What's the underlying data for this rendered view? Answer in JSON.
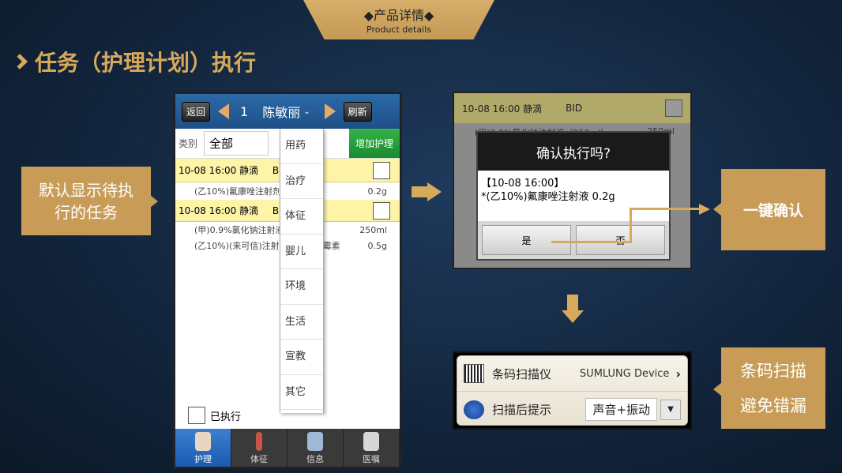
{
  "banner": {
    "title": "◆产品详情◆",
    "subtitle": "Product details"
  },
  "heading": "任务（护理计划）执行",
  "callouts": {
    "left": "默认显示待执行的任务",
    "confirm": "一键确认",
    "scan": "条码扫描",
    "scan2": "避免错漏"
  },
  "phone": {
    "back": "返回",
    "index": "1",
    "patient": "陈敏丽",
    "refresh": "刷新",
    "category_label": "类别",
    "category_value": "全部",
    "add_btn": "增加护理",
    "tasks": [
      {
        "header": "10-08 16:00 静滴",
        "freq": "B",
        "lines": [
          {
            "name": "(乙10%)氟康唑注射剂",
            "amount": "0.2g"
          }
        ]
      },
      {
        "header": "10-08 16:00 静滴",
        "freq": "B",
        "lines": [
          {
            "name": "(甲)0.9%氯化钠注射液",
            "amount": "250ml"
          },
          {
            "name": "(乙10%)(来可信)注射用头孢…古霉素",
            "amount": "0.5g"
          }
        ]
      }
    ],
    "menu": [
      "用药",
      "治疗",
      "体征",
      "婴儿",
      "环境",
      "生活",
      "宣教",
      "其它"
    ],
    "done_label": "已执行",
    "tabs": [
      {
        "label": "护理"
      },
      {
        "label": "体征"
      },
      {
        "label": "信息"
      },
      {
        "label": "医嘱"
      }
    ]
  },
  "dialog": {
    "bg_row1": "10-08 16:00 静滴",
    "bg_freq": "BID",
    "bg_line": "(甲)0.9%氯化钠注射液（250ml）",
    "bg_amount": "250ml",
    "title": "确认执行吗?",
    "line1": "【10-08 16:00】",
    "line2": "*(乙10%)氟康唑注射液 0.2g",
    "yes": "是",
    "no": "否"
  },
  "scanner": {
    "row1_label": "条码扫描仪",
    "row1_value": "SUMLUNG Device",
    "row2_label": "扫描后提示",
    "row2_value": "声音+振动"
  }
}
